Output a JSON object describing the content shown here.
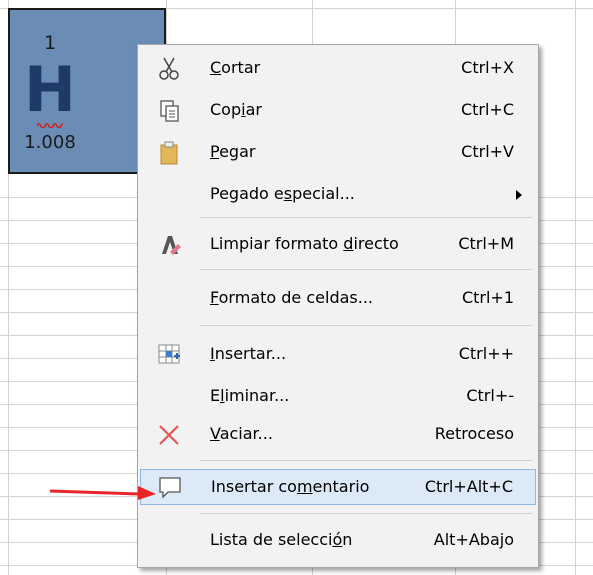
{
  "cell": {
    "atomic_number": "1",
    "symbol": "H",
    "atomic_mass": "1.008"
  },
  "menu": {
    "items": [
      {
        "pre": "",
        "u": "C",
        "post": "ortar",
        "shortcut": "Ctrl+X",
        "icon": "scissors-icon"
      },
      {
        "pre": "Cop",
        "u": "i",
        "post": "ar",
        "shortcut": "Ctrl+C",
        "icon": "copy-icon"
      },
      {
        "pre": "",
        "u": "P",
        "post": "egar",
        "shortcut": "Ctrl+V",
        "icon": "paste-icon"
      },
      {
        "pre": "Pegado e",
        "u": "s",
        "post": "pecial...",
        "shortcut": "",
        "icon": ""
      },
      {
        "pre": "Limpiar formato ",
        "u": "d",
        "post": "irecto",
        "shortcut": "Ctrl+M",
        "icon": "clear-format-icon"
      },
      {
        "pre": "",
        "u": "F",
        "post": "ormato de celdas...",
        "shortcut": "Ctrl+1",
        "icon": ""
      },
      {
        "pre": "",
        "u": "I",
        "post": "nsertar...",
        "shortcut": "Ctrl++",
        "icon": "insert-cells-icon"
      },
      {
        "pre": "E",
        "u": "l",
        "post": "iminar...",
        "shortcut": "Ctrl+-",
        "icon": ""
      },
      {
        "pre": "",
        "u": "V",
        "post": "aciar...",
        "shortcut": "Retroceso",
        "icon": "delete-x-icon"
      },
      {
        "pre": "Insertar co",
        "u": "m",
        "post": "entario",
        "shortcut": "Ctrl+Alt+C",
        "icon": "comment-icon"
      },
      {
        "pre": "Lista de selecci",
        "u": "ó",
        "post": "n",
        "shortcut": "Alt+Abajo",
        "icon": ""
      }
    ]
  },
  "colors": {
    "cell_bg": "#6b8db5",
    "highlight_bg": "#dce9f7",
    "arrow": "#e8262a"
  }
}
